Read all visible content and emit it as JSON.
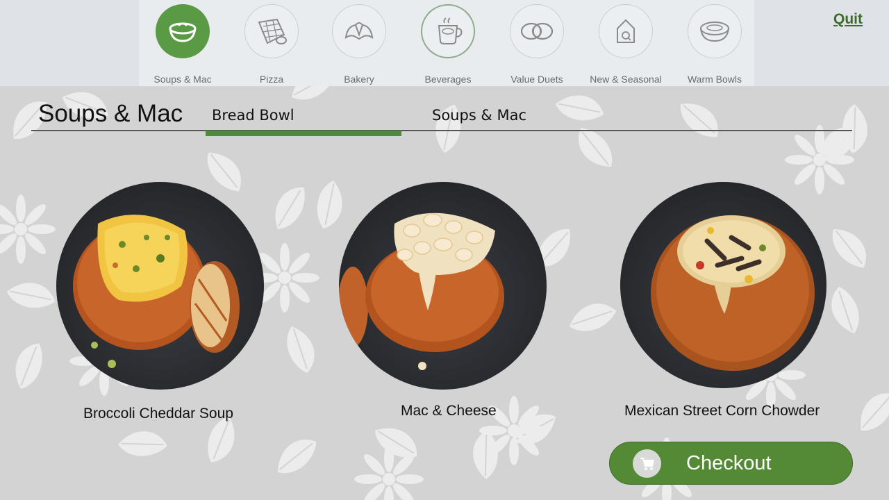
{
  "categories": [
    {
      "label": "Soups & Mac",
      "icon": "soup-bowl-icon",
      "active": true
    },
    {
      "label": "Pizza",
      "icon": "pizza-icon"
    },
    {
      "label": "Bakery",
      "icon": "croissant-icon"
    },
    {
      "label": "Beverages",
      "icon": "coffee-cup-icon"
    },
    {
      "label": "Value Duets",
      "icon": "duet-rings-icon"
    },
    {
      "label": "New & Seasonal",
      "icon": "seasonal-house-icon"
    },
    {
      "label": "Warm Bowls",
      "icon": "warm-bowl-icon"
    }
  ],
  "header": {
    "quit_label": "Quit",
    "page_title": "Soups & Mac"
  },
  "tabs": [
    {
      "label": "Bread Bowl",
      "active": true
    },
    {
      "label": "Soups & Mac",
      "active": false
    }
  ],
  "products": [
    {
      "name": "Broccoli Cheddar Soup",
      "image": "broccoli-cheddar-bread-bowl"
    },
    {
      "name": "Mac & Cheese",
      "image": "mac-cheese-bread-bowl"
    },
    {
      "name": "Mexican Street Corn Chowder",
      "image": "corn-chowder-bread-bowl"
    }
  ],
  "checkout": {
    "label": "Checkout",
    "icon": "cart-icon"
  },
  "colors": {
    "brand_green": "#548a36",
    "active_tab": "#4e8a3a",
    "quit": "#3d6b2c"
  }
}
